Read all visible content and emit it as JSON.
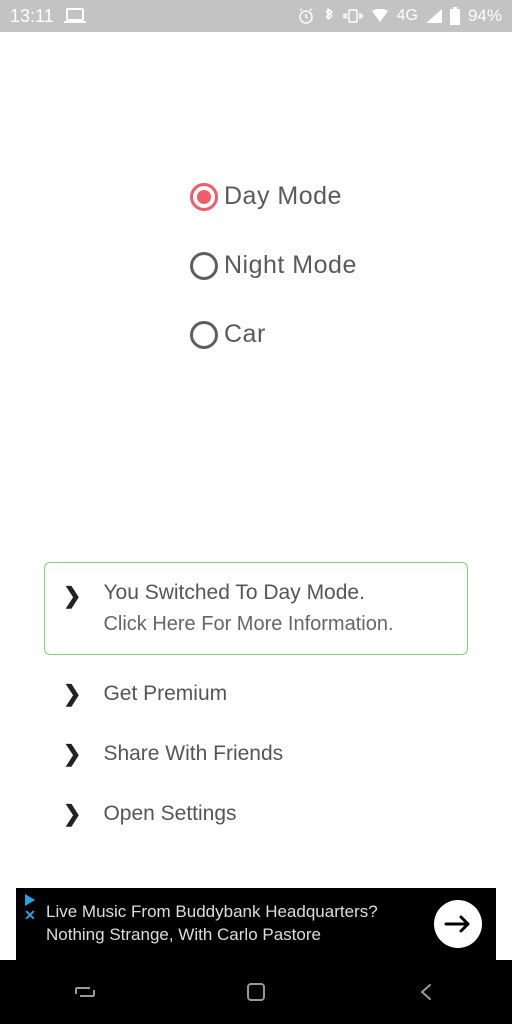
{
  "status": {
    "time": "13:11",
    "network": "4G",
    "battery": "94%"
  },
  "radios": {
    "day": "Day Mode",
    "night": "Night Mode",
    "car": "Car"
  },
  "items": {
    "switched_line1": "You Switched To Day Mode.",
    "switched_line2": "Click Here For More Information.",
    "premium": "Get Premium",
    "share": "Share With Friends",
    "settings": "Open Settings"
  },
  "ad": {
    "line1": "Live Music From Buddybank Headquarters?",
    "line2": "Nothing Strange, With Carlo Pastore"
  }
}
